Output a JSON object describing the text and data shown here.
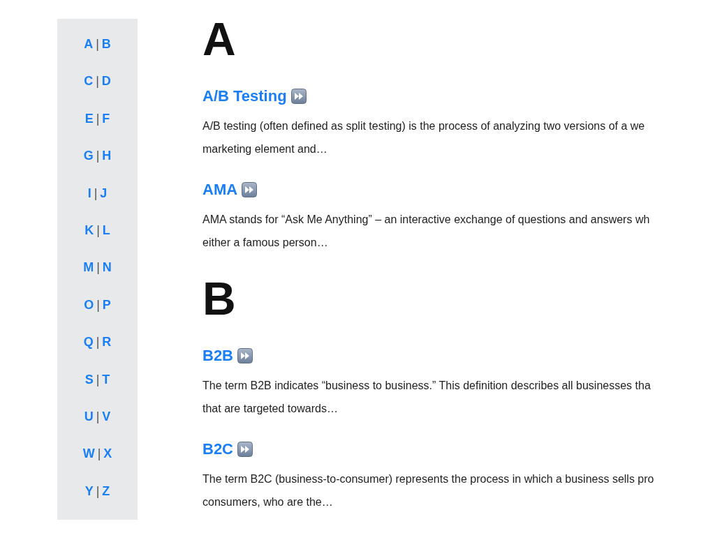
{
  "sidebar": {
    "items": [
      {
        "left": "A",
        "right": "B",
        "separator": "|"
      },
      {
        "left": "C",
        "right": "D",
        "separator": "|"
      },
      {
        "left": "E",
        "right": "F",
        "separator": "|"
      },
      {
        "left": "G",
        "right": "H",
        "separator": "|"
      },
      {
        "left": "I",
        "right": "J",
        "separator": "|"
      },
      {
        "left": "K",
        "right": "L",
        "separator": "|"
      },
      {
        "left": "M",
        "right": "N",
        "separator": "|"
      },
      {
        "left": "O",
        "right": "P",
        "separator": "|"
      },
      {
        "left": "Q",
        "right": "R",
        "separator": "|"
      },
      {
        "left": "S",
        "right": "T",
        "separator": "|"
      },
      {
        "left": "U",
        "right": "V",
        "separator": "|"
      },
      {
        "left": "W",
        "right": "X",
        "separator": "|"
      },
      {
        "left": "Y",
        "right": "Z",
        "separator": "|"
      }
    ]
  },
  "sections": [
    {
      "letter": "A",
      "entries": [
        {
          "term": "A/B Testing",
          "description": [
            "A/B testing (often defined as split testing) is the process of analyzing two versions of a we",
            "marketing element and…"
          ]
        },
        {
          "term": "AMA",
          "description": [
            "AMA stands for “Ask Me Anything” – an interactive exchange of questions and answers wh",
            "either a famous person…"
          ]
        }
      ]
    },
    {
      "letter": "B",
      "entries": [
        {
          "term": "B2B",
          "description": [
            "The term B2B indicates “business to business.” This definition describes all businesses tha",
            "that are targeted towards…"
          ]
        },
        {
          "term": "B2C",
          "description": [
            "The term B2C (business-to-consumer) represents the process in which a business sells pro",
            "consumers, who are the…"
          ]
        }
      ]
    }
  ]
}
